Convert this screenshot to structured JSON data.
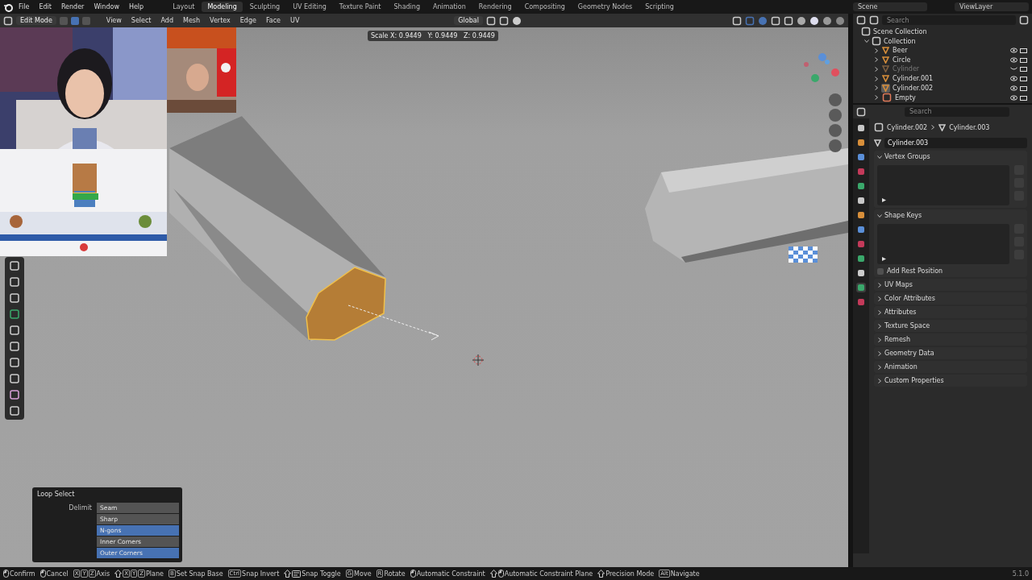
{
  "topbar": {
    "menu": [
      "File",
      "Edit",
      "Render",
      "Window",
      "Help"
    ],
    "workspaces": [
      {
        "label": "Layout",
        "selected": false
      },
      {
        "label": "Modeling",
        "selected": true
      },
      {
        "label": "Sculpting",
        "selected": false
      },
      {
        "label": "UV Editing",
        "selected": false
      },
      {
        "label": "Texture Paint",
        "selected": false
      },
      {
        "label": "Shading",
        "selected": false
      },
      {
        "label": "Animation",
        "selected": false
      },
      {
        "label": "Rendering",
        "selected": false
      },
      {
        "label": "Compositing",
        "selected": false
      },
      {
        "label": "Geometry Nodes",
        "selected": false
      },
      {
        "label": "Scripting",
        "selected": false
      }
    ],
    "scene": "Scene",
    "view_layer": "ViewLayer"
  },
  "viewport_header": {
    "mode": "Edit Mode",
    "select_modes": [
      {
        "selected": false
      },
      {
        "selected": true
      },
      {
        "selected": false
      }
    ],
    "menus": [
      "View",
      "Select",
      "Add",
      "Mesh",
      "Vertex",
      "Edge",
      "Face",
      "UV"
    ],
    "orientation": "Global"
  },
  "viewport": {
    "readout": "Scale X: 0.9449   Y: 0.9449   Z: 0.9449"
  },
  "loop_select": {
    "title": "Loop Select",
    "label": "Delimit",
    "options": [
      {
        "label": "Seam",
        "selected": false
      },
      {
        "label": "Sharp",
        "selected": false
      },
      {
        "label": "N-gons",
        "selected": true
      },
      {
        "label": "Inner Corners",
        "selected": false
      },
      {
        "label": "Outer Corners",
        "selected": true
      }
    ]
  },
  "outliner": {
    "search": {
      "placeholder": "Search"
    },
    "root": "Scene Collection",
    "collection": {
      "label": "Collection",
      "expanded": true,
      "children": [
        {
          "label": "Beer",
          "kind": "mesh",
          "visible": true,
          "selected": false
        },
        {
          "label": "Circle",
          "kind": "mesh",
          "visible": true,
          "selected": false
        },
        {
          "label": "Cylinder",
          "kind": "mesh",
          "visible": false,
          "selected": false
        },
        {
          "label": "Cylinder.001",
          "kind": "mesh",
          "visible": true,
          "selected": false
        },
        {
          "label": "Cylinder.002",
          "kind": "mesh",
          "visible": true,
          "selected": true
        },
        {
          "label": "Empty",
          "kind": "empty",
          "visible": true,
          "selected": false
        }
      ]
    }
  },
  "properties": {
    "search": {
      "placeholder": "Search"
    },
    "breadcrumb": [
      "Cylinder.002",
      "Cylinder.003"
    ],
    "mesh_name": "Cylinder.003",
    "list_panels": [
      {
        "title": "Vertex Groups",
        "expanded": true
      },
      {
        "title": "Shape Keys",
        "expanded": true
      }
    ],
    "rest_position": {
      "label": "Add Rest Position",
      "checked": false
    },
    "panels": [
      {
        "title": "UV Maps",
        "expanded": false
      },
      {
        "title": "Color Attributes",
        "expanded": false
      },
      {
        "title": "Attributes",
        "expanded": false
      },
      {
        "title": "Texture Space",
        "expanded": false
      },
      {
        "title": "Remesh",
        "expanded": false
      },
      {
        "title": "Geometry Data",
        "expanded": false
      },
      {
        "title": "Animation",
        "expanded": false
      },
      {
        "title": "Custom Properties",
        "expanded": false
      }
    ]
  },
  "status_bar": {
    "items": [
      {
        "kind": "mouse",
        "label": "Confirm"
      },
      {
        "kind": "mouse",
        "label": "Cancel"
      },
      {
        "kind": "keys",
        "keys": [
          "X",
          "Y",
          "Z"
        ],
        "label": "Axis"
      },
      {
        "kind": "shiftkeys",
        "keys": [
          "X",
          "Y",
          "Z"
        ],
        "label": "Plane"
      },
      {
        "kind": "keys",
        "keys": [
          "B"
        ],
        "label": "Set Snap Base"
      },
      {
        "kind": "keys",
        "keys": [
          "Ctrl"
        ],
        "label": "Snap Invert"
      },
      {
        "kind": "shiftboard",
        "label": "Snap Toggle"
      },
      {
        "kind": "keys",
        "keys": [
          "G"
        ],
        "label": "Move"
      },
      {
        "kind": "keys",
        "keys": [
          "R"
        ],
        "label": "Rotate"
      },
      {
        "kind": "mouse",
        "label": "Automatic Constraint"
      },
      {
        "kind": "shiftmouse",
        "label": "Automatic Constraint Plane"
      },
      {
        "kind": "shift",
        "label": "Precision Mode"
      },
      {
        "kind": "keys",
        "keys": [
          "Alt"
        ],
        "label": "Navigate"
      }
    ],
    "version": "5.1.0"
  }
}
